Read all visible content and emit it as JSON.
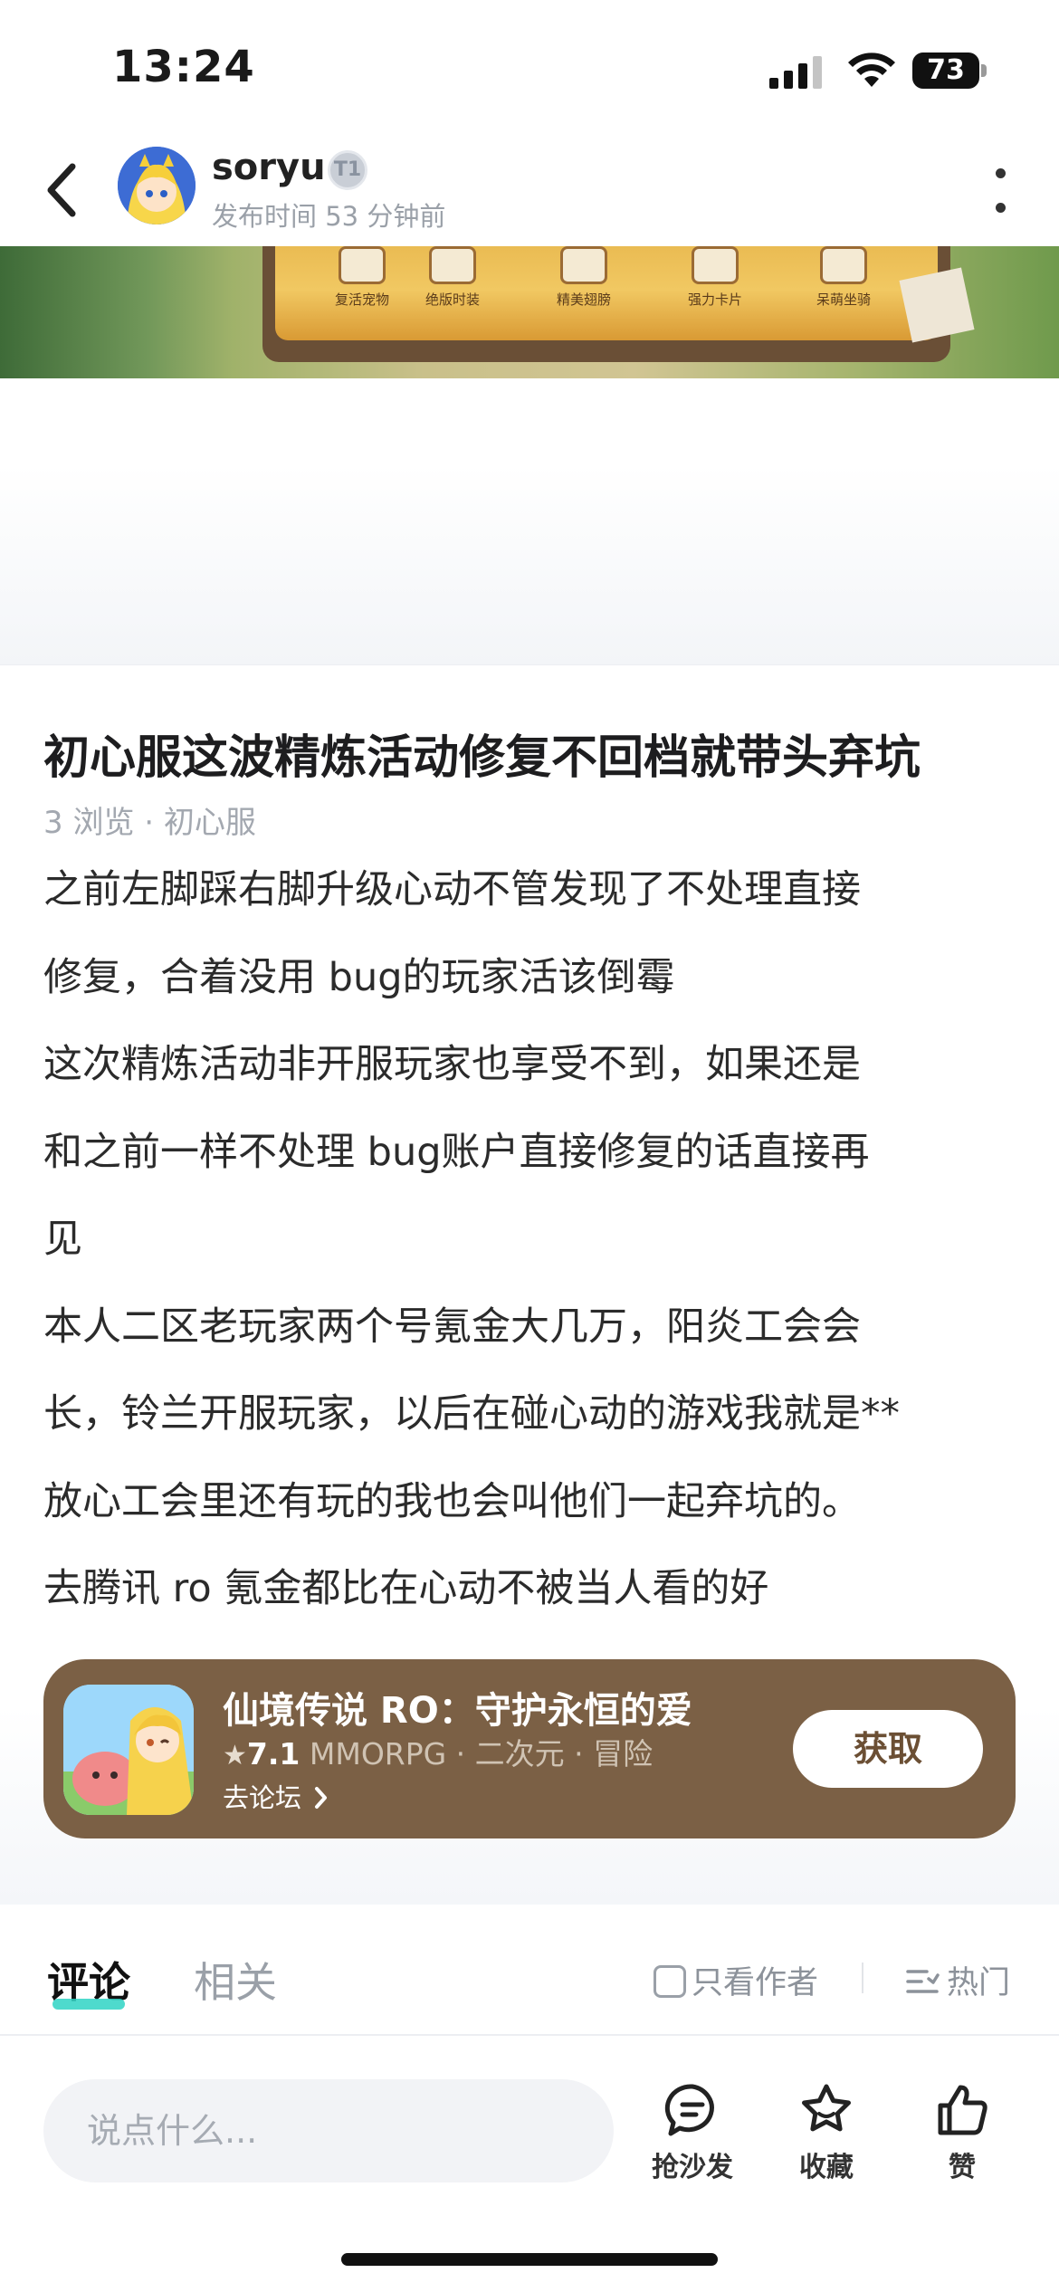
{
  "status_bar": {
    "time": "13:24",
    "battery": "73"
  },
  "header": {
    "author_name": "soryu",
    "level_badge": "T1",
    "post_time": "发布时间 53 分钟前"
  },
  "banner": {
    "items": [
      "复活宠物",
      "绝版时装",
      "精美翅膀",
      "强力卡片",
      "呆萌坐骑"
    ]
  },
  "post": {
    "title": "初心服这波精炼活动修复不回档就带头弃坑",
    "meta": "3 浏览 · 初心服",
    "body_lines": [
      "之前左脚踩右脚升级心动不管发现了不处理直接",
      "修复，合着没用 bug的玩家活该倒霉",
      "这次精炼活动非开服玩家也享受不到，如果还是",
      "和之前一样不处理 bug账户直接修复的话直接再",
      "见",
      "本人二区老玩家两个号氪金大几万，阳炎工会会",
      "长，铃兰开服玩家，以后在碰心动的游戏我就是**",
      "放心工会里还有玩的我也会叫他们一起弃坑的。",
      "去腾讯 ro 氪金都比在心动不被当人看的好"
    ]
  },
  "game_card": {
    "name": "仙境传说 RO：守护永恒的爱",
    "rating": "7.1",
    "tags": "MMORPG · 二次元 · 冒险",
    "forum_link": "去论坛",
    "get_button": "获取",
    "bg_color": "#7b6045"
  },
  "tabs": {
    "comments": "评论",
    "related": "相关",
    "only_author": "只看作者",
    "sort": "热门",
    "accent_color": "#2fd3c4"
  },
  "bottom_bar": {
    "input_placeholder": "说点什么...",
    "actions": [
      {
        "label": "抢沙发",
        "icon": "comment-bubble-icon"
      },
      {
        "label": "收藏",
        "icon": "star-icon"
      },
      {
        "label": "赞",
        "icon": "thumbs-up-icon"
      }
    ]
  }
}
